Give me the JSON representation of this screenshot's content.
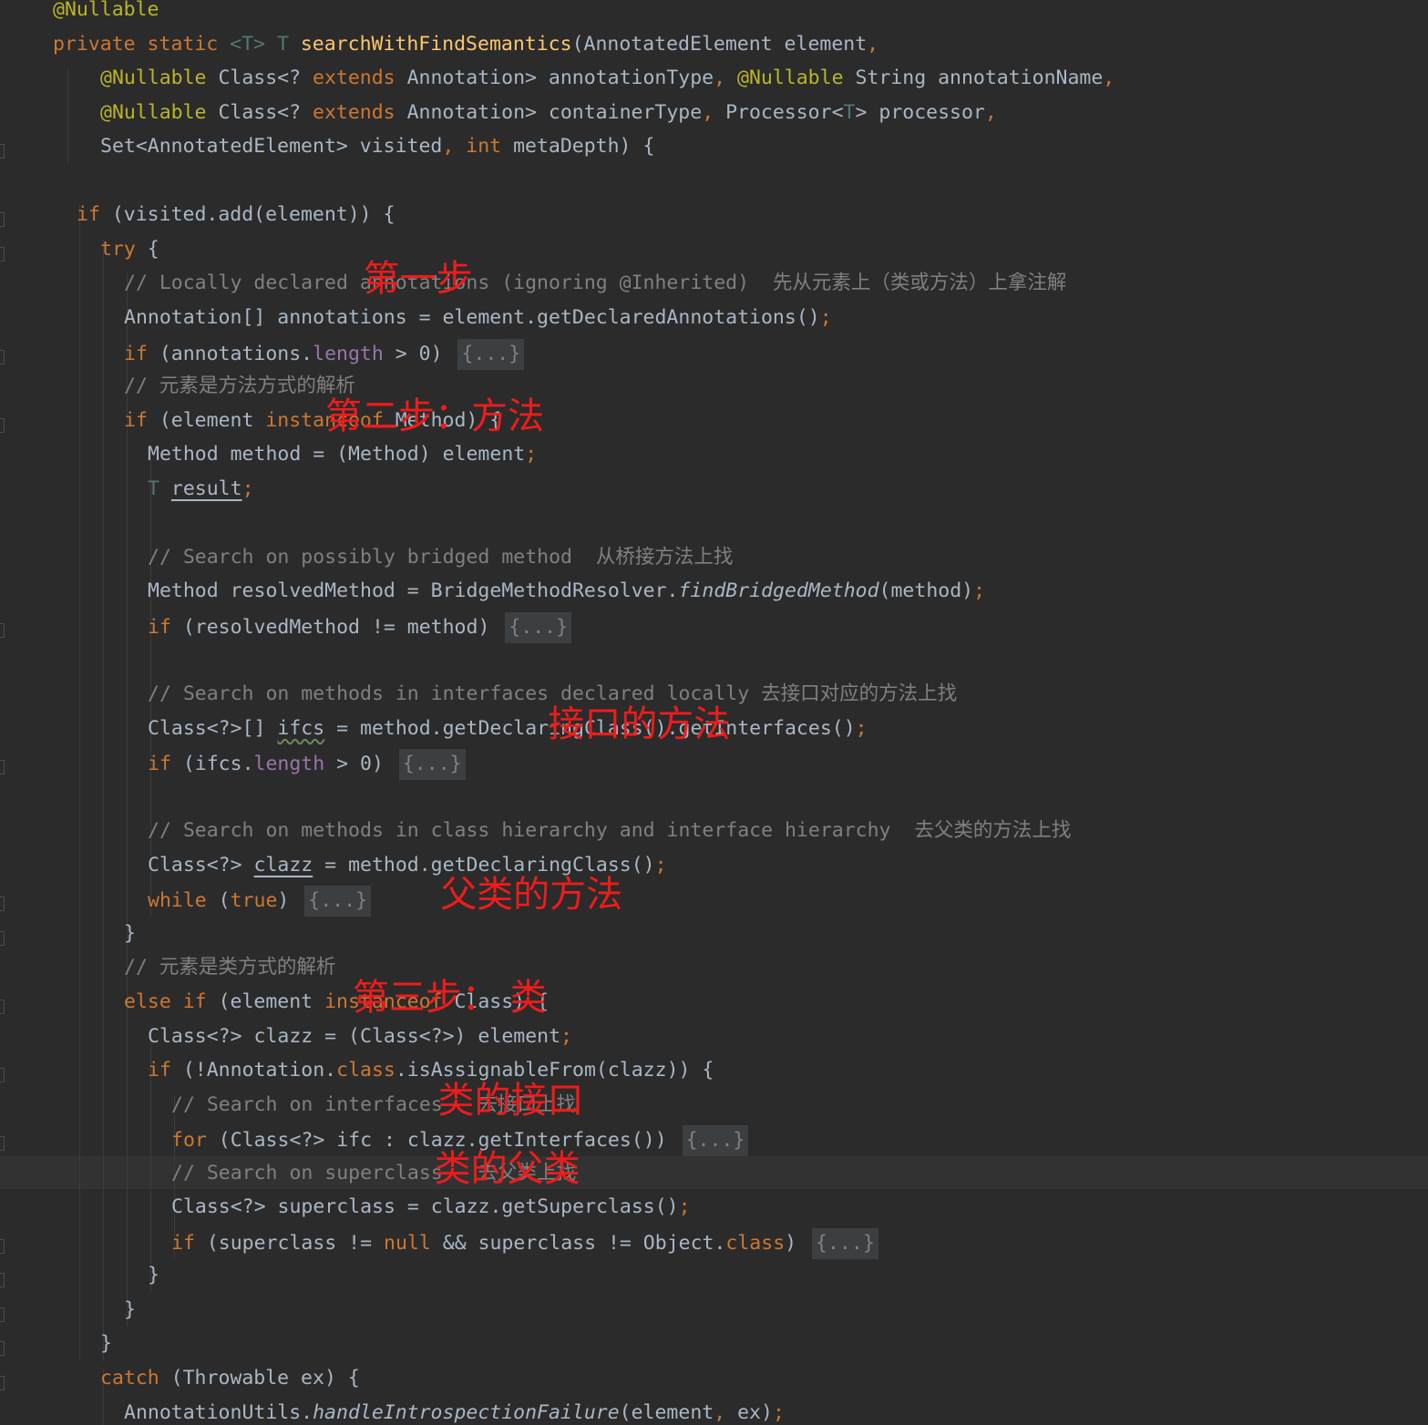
{
  "lines": [
    {
      "indent": 0,
      "tokens": [
        {
          "t": "@Nullable",
          "c": "ann"
        }
      ]
    },
    {
      "indent": 0,
      "tokens": [
        {
          "t": "private static ",
          "c": "kw"
        },
        {
          "t": "<T> ",
          "c": "tp"
        },
        {
          "t": "T ",
          "c": "tp"
        },
        {
          "t": "searchWithFindSemantics",
          "c": "fn"
        },
        {
          "t": "(AnnotatedElement element",
          "c": ""
        },
        {
          "t": ",",
          "c": "kw"
        }
      ]
    },
    {
      "indent": 4,
      "tokens": [
        {
          "t": "@Nullable ",
          "c": "ann"
        },
        {
          "t": "Class<? ",
          "c": ""
        },
        {
          "t": "extends ",
          "c": "kw"
        },
        {
          "t": "Annotation> annotationType",
          "c": ""
        },
        {
          "t": ", ",
          "c": "kw"
        },
        {
          "t": "@Nullable ",
          "c": "ann"
        },
        {
          "t": "String annotationName",
          "c": ""
        },
        {
          "t": ",",
          "c": "kw"
        }
      ]
    },
    {
      "indent": 4,
      "tokens": [
        {
          "t": "@Nullable ",
          "c": "ann"
        },
        {
          "t": "Class<? ",
          "c": ""
        },
        {
          "t": "extends ",
          "c": "kw"
        },
        {
          "t": "Annotation> containerType",
          "c": ""
        },
        {
          "t": ", ",
          "c": "kw"
        },
        {
          "t": "Processor<",
          "c": ""
        },
        {
          "t": "T",
          "c": "tp"
        },
        {
          "t": "> processor",
          "c": ""
        },
        {
          "t": ",",
          "c": "kw"
        }
      ]
    },
    {
      "indent": 4,
      "tokens": [
        {
          "t": "Set<AnnotatedElement> visited",
          "c": ""
        },
        {
          "t": ", ",
          "c": "kw"
        },
        {
          "t": "int ",
          "c": "kw"
        },
        {
          "t": "metaDepth) {",
          "c": ""
        }
      ]
    },
    {
      "indent": 0,
      "tokens": []
    },
    {
      "indent": 2,
      "tokens": [
        {
          "t": "if ",
          "c": "kw"
        },
        {
          "t": "(visited.add(element)) {",
          "c": ""
        }
      ]
    },
    {
      "indent": 4,
      "tokens": [
        {
          "t": "try ",
          "c": "kw"
        },
        {
          "t": "{",
          "c": ""
        }
      ]
    },
    {
      "indent": 6,
      "tokens": [
        {
          "t": "// Locally declared annotations (ignoring @Inherited)  先从元素上（类或方法）上拿注解",
          "c": "cm"
        }
      ]
    },
    {
      "indent": 6,
      "tokens": [
        {
          "t": "Annotation[] annotations = element.getDeclaredAnnotations()",
          "c": ""
        },
        {
          "t": ";",
          "c": "kw"
        }
      ]
    },
    {
      "indent": 6,
      "tokens": [
        {
          "t": "if ",
          "c": "kw"
        },
        {
          "t": "(annotations.",
          "c": ""
        },
        {
          "t": "length ",
          "c": "fd"
        },
        {
          "t": "> 0) ",
          "c": ""
        },
        {
          "t": "{...}",
          "c": "fold"
        }
      ]
    },
    {
      "indent": 6,
      "tokens": [
        {
          "t": "// 元素是方法方式的解析",
          "c": "cm"
        }
      ]
    },
    {
      "indent": 6,
      "tokens": [
        {
          "t": "if ",
          "c": "kw"
        },
        {
          "t": "(element ",
          "c": ""
        },
        {
          "t": "instanceof ",
          "c": "kw"
        },
        {
          "t": "Method) {",
          "c": ""
        }
      ]
    },
    {
      "indent": 8,
      "tokens": [
        {
          "t": "Method method = (Method) element",
          "c": ""
        },
        {
          "t": ";",
          "c": "kw"
        }
      ]
    },
    {
      "indent": 8,
      "tokens": [
        {
          "t": "T ",
          "c": "tp"
        },
        {
          "t": "result",
          "c": "ul"
        },
        {
          "t": ";",
          "c": "kw"
        }
      ]
    },
    {
      "indent": 0,
      "tokens": []
    },
    {
      "indent": 8,
      "tokens": [
        {
          "t": "// Search on possibly bridged method  从桥接方法上找",
          "c": "cm"
        }
      ]
    },
    {
      "indent": 8,
      "tokens": [
        {
          "t": "Method resolvedMethod = BridgeMethodResolver.",
          "c": ""
        },
        {
          "t": "findBridgedMethod",
          "c": "it"
        },
        {
          "t": "(method)",
          "c": ""
        },
        {
          "t": ";",
          "c": "kw"
        }
      ]
    },
    {
      "indent": 8,
      "tokens": [
        {
          "t": "if ",
          "c": "kw"
        },
        {
          "t": "(resolvedMethod != method) ",
          "c": ""
        },
        {
          "t": "{...}",
          "c": "fold"
        }
      ]
    },
    {
      "indent": 0,
      "tokens": []
    },
    {
      "indent": 8,
      "tokens": [
        {
          "t": "// Search on methods in interfaces declared locally 去接口对应的方法上找",
          "c": "cm"
        }
      ]
    },
    {
      "indent": 8,
      "tokens": [
        {
          "t": "Class<?>[] ",
          "c": ""
        },
        {
          "t": "ifcs",
          "c": "sq"
        },
        {
          "t": " = method.getDeclaringClass().getInterfaces()",
          "c": ""
        },
        {
          "t": ";",
          "c": "kw"
        }
      ]
    },
    {
      "indent": 8,
      "tokens": [
        {
          "t": "if ",
          "c": "kw"
        },
        {
          "t": "(ifcs.",
          "c": ""
        },
        {
          "t": "length ",
          "c": "fd"
        },
        {
          "t": "> 0) ",
          "c": ""
        },
        {
          "t": "{...}",
          "c": "fold"
        }
      ]
    },
    {
      "indent": 0,
      "tokens": []
    },
    {
      "indent": 8,
      "tokens": [
        {
          "t": "// Search on methods in class hierarchy and interface hierarchy  去父类的方法上找",
          "c": "cm"
        }
      ]
    },
    {
      "indent": 8,
      "tokens": [
        {
          "t": "Class<?> ",
          "c": ""
        },
        {
          "t": "clazz",
          "c": "ul"
        },
        {
          "t": " = method.getDeclaringClass()",
          "c": ""
        },
        {
          "t": ";",
          "c": "kw"
        }
      ]
    },
    {
      "indent": 8,
      "tokens": [
        {
          "t": "while ",
          "c": "kw"
        },
        {
          "t": "(",
          "c": ""
        },
        {
          "t": "true",
          "c": "kw"
        },
        {
          "t": ") ",
          "c": ""
        },
        {
          "t": "{...}",
          "c": "fold"
        }
      ]
    },
    {
      "indent": 6,
      "tokens": [
        {
          "t": "}",
          "c": ""
        }
      ]
    },
    {
      "indent": 6,
      "tokens": [
        {
          "t": "// 元素是类方式的解析",
          "c": "cm"
        }
      ]
    },
    {
      "indent": 6,
      "tokens": [
        {
          "t": "else if ",
          "c": "kw"
        },
        {
          "t": "(element ",
          "c": ""
        },
        {
          "t": "instanceof ",
          "c": "kw"
        },
        {
          "t": "Class) {",
          "c": ""
        }
      ]
    },
    {
      "indent": 8,
      "tokens": [
        {
          "t": "Class<?> clazz = (Class<?>) element",
          "c": ""
        },
        {
          "t": ";",
          "c": "kw"
        }
      ]
    },
    {
      "indent": 8,
      "tokens": [
        {
          "t": "if ",
          "c": "kw"
        },
        {
          "t": "(!Annotation.",
          "c": ""
        },
        {
          "t": "class",
          "c": "kw"
        },
        {
          "t": ".isAssignableFrom(clazz)) {",
          "c": ""
        }
      ]
    },
    {
      "indent": 10,
      "tokens": [
        {
          "t": "// Search on interfaces   去接口上找",
          "c": "cm"
        }
      ]
    },
    {
      "indent": 10,
      "tokens": [
        {
          "t": "for ",
          "c": "kw"
        },
        {
          "t": "(Class<?> ifc : clazz.getInterfaces()) ",
          "c": ""
        },
        {
          "t": "{...}",
          "c": "fold"
        }
      ]
    },
    {
      "indent": 10,
      "tokens": [
        {
          "t": "// Search on superclass   去父类上找",
          "c": "cm"
        }
      ]
    },
    {
      "indent": 10,
      "tokens": [
        {
          "t": "Class<?> superclass = clazz.getSuperclass()",
          "c": ""
        },
        {
          "t": ";",
          "c": "kw"
        }
      ]
    },
    {
      "indent": 10,
      "tokens": [
        {
          "t": "if ",
          "c": "kw"
        },
        {
          "t": "(superclass != ",
          "c": ""
        },
        {
          "t": "null ",
          "c": "kw"
        },
        {
          "t": "&& superclass != Object.",
          "c": ""
        },
        {
          "t": "class",
          "c": "kw"
        },
        {
          "t": ") ",
          "c": ""
        },
        {
          "t": "{...}",
          "c": "fold"
        }
      ]
    },
    {
      "indent": 8,
      "tokens": [
        {
          "t": "}",
          "c": ""
        }
      ]
    },
    {
      "indent": 6,
      "tokens": [
        {
          "t": "}",
          "c": ""
        }
      ]
    },
    {
      "indent": 4,
      "tokens": [
        {
          "t": "}",
          "c": ""
        }
      ]
    },
    {
      "indent": 4,
      "tokens": [
        {
          "t": "catch ",
          "c": "kw"
        },
        {
          "t": "(Throwable ex) {",
          "c": ""
        }
      ]
    },
    {
      "indent": 6,
      "tokens": [
        {
          "t": "AnnotationUtils.",
          "c": ""
        },
        {
          "t": "handleIntrospectionFailure",
          "c": "it"
        },
        {
          "t": "(element",
          "c": ""
        },
        {
          "t": ", ",
          "c": "kw"
        },
        {
          "t": "ex)",
          "c": ""
        },
        {
          "t": ";",
          "c": "kw"
        }
      ]
    }
  ],
  "annotations": [
    {
      "text": "第一步",
      "line": 8,
      "col": 26.2
    },
    {
      "text": "第二步：方法",
      "line": 12,
      "col": 23.0
    },
    {
      "text": "接口的方法",
      "line": 21,
      "col": 41.8
    },
    {
      "text": "父类的方法",
      "line": 26,
      "col": 32.7
    },
    {
      "text": "第三步： 类",
      "line": 29,
      "col": 25.3
    },
    {
      "text": "类的接口",
      "line": 32,
      "col": 32.5
    },
    {
      "text": "类的父类",
      "line": 34,
      "col": 32.2
    }
  ],
  "colors": {
    "background": "#2b2b2b",
    "text": "#a9b7c6",
    "keyword": "#cc7832",
    "annotation": "#bbb529",
    "method_declaration": "#ffc66d",
    "comment": "#808080",
    "type_parameter": "#507874",
    "field": "#9876aa",
    "fold_placeholder_bg": "#3c3f41",
    "handwritten_note": "#ee1c1c"
  }
}
